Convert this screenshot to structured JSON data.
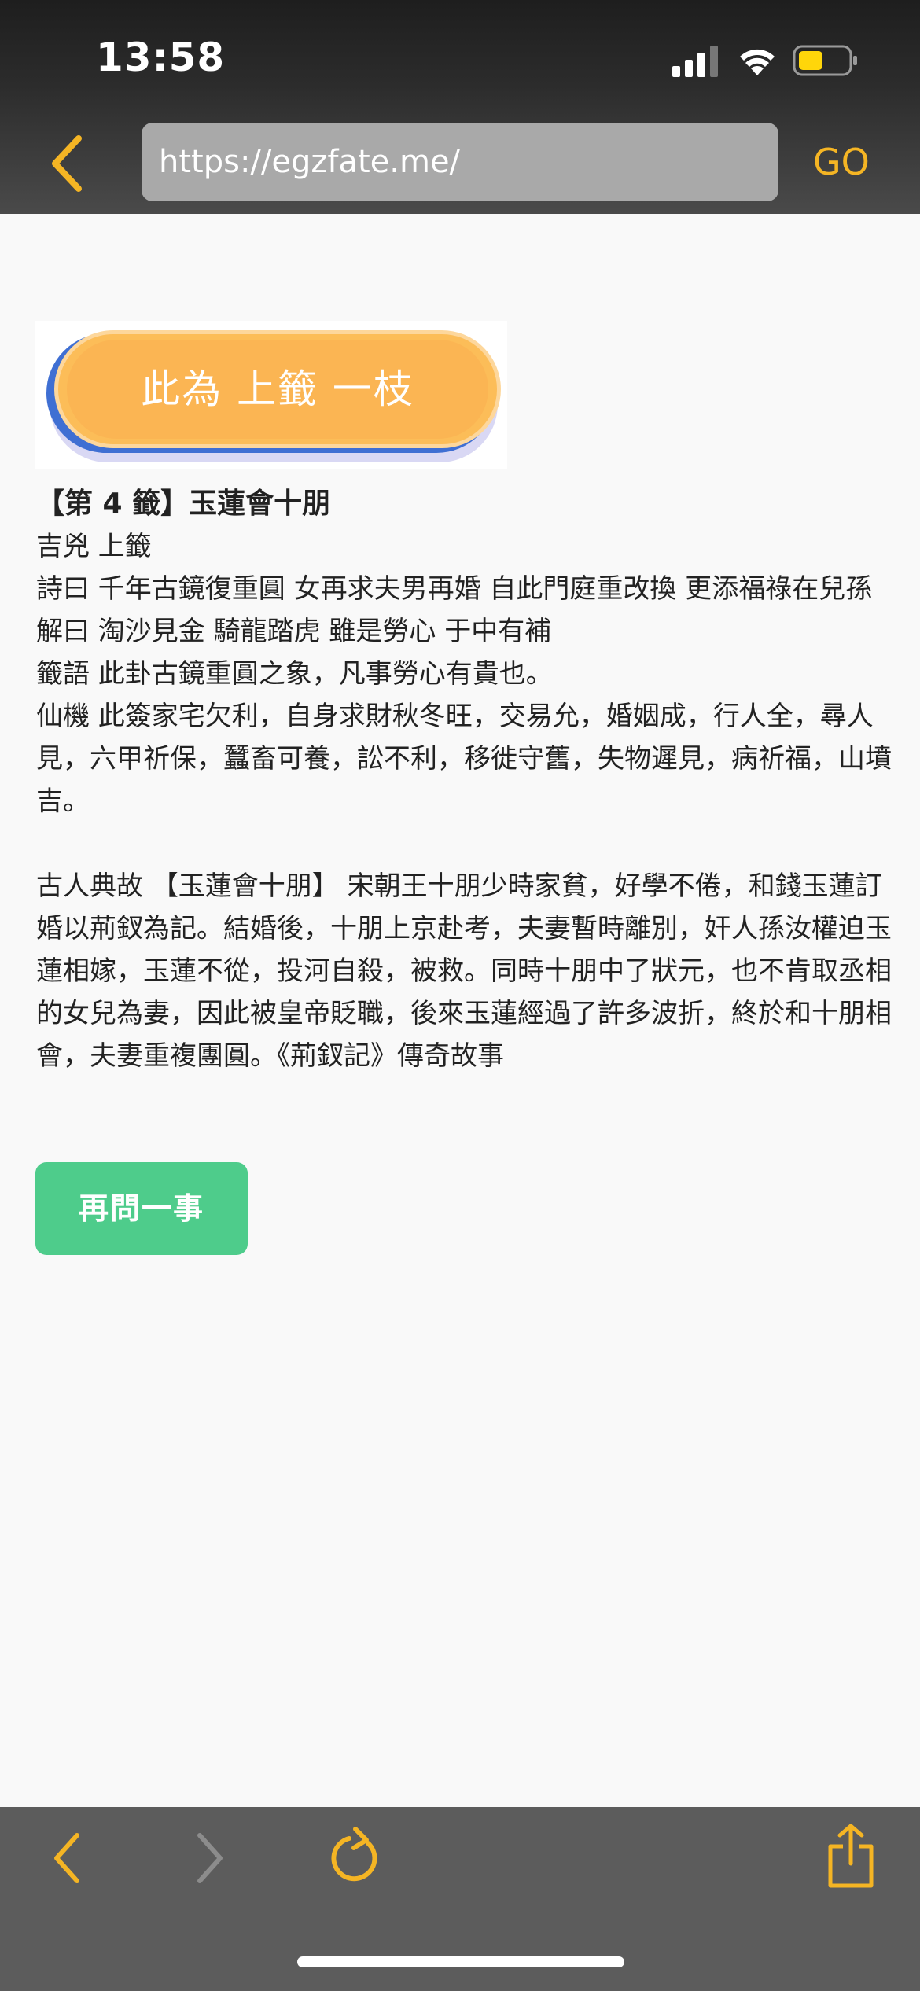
{
  "status_bar": {
    "time": "13:58"
  },
  "browser": {
    "url": "https://egzfate.me/",
    "go_label": "GO",
    "accent": "#f5b524"
  },
  "banner": {
    "text": "此為 上籤 一枝"
  },
  "result": {
    "title": "【第 4 籤】玉蓮會十朋",
    "lines": [
      "吉兇 上籤",
      "詩曰 千年古鏡復重圓 女再求夫男再婚 自此門庭重改換 更添福祿在兒孫",
      "解曰 淘沙見金 騎龍踏虎 雖是勞心 于中有補",
      "籤語 此卦古鏡重圓之象，凡事勞心有貴也。",
      "仙機 此簽家宅欠利，自身求財秋冬旺，交易允，婚姻成，行人全，尋人見，六甲祈保，蠶畜可養，訟不利，移徙守舊，失物遲見，病祈福，山墳吉。"
    ],
    "story": "古人典故 【玉蓮會十朋】 宋朝王十朋少時家貧，好學不倦，和錢玉蓮訂婚以荊釵為記。結婚後，十朋上京赴考，夫妻暫時離別，奸人孫汝權迫玉蓮相嫁，玉蓮不從，投河自殺，被救。同時十朋中了狀元，也不肯取丞相的女兒為妻，因此被皇帝貶職，後來玉蓮經過了許多波折，終於和十朋相會，夫妻重複團圓。《荊釵記》傳奇故事"
  },
  "actions": {
    "ask_again_label": "再問一事",
    "button_color": "#4ecc8b"
  },
  "toolbar": {
    "icons": [
      "back-icon",
      "forward-icon",
      "reload-icon",
      "share-icon"
    ]
  }
}
